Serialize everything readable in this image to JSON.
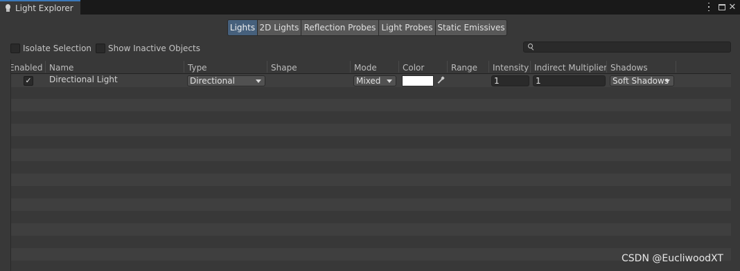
{
  "window": {
    "title": "Light Explorer",
    "icon": "light-bulb-icon"
  },
  "toolbar": {
    "tabs": [
      {
        "label": "Lights",
        "active": true
      },
      {
        "label": "2D Lights",
        "active": false
      },
      {
        "label": "Reflection Probes",
        "active": false
      },
      {
        "label": "Light Probes",
        "active": false
      },
      {
        "label": "Static Emissives",
        "active": false
      }
    ]
  },
  "filters": {
    "isolate_selection": {
      "label": "Isolate Selection",
      "checked": false
    },
    "show_inactive": {
      "label": "Show Inactive Objects",
      "checked": false
    },
    "search": {
      "value": "",
      "placeholder": ""
    }
  },
  "table": {
    "columns": [
      "Enabled",
      "Name",
      "Type",
      "Shape",
      "Mode",
      "Color",
      "Range",
      "Intensity",
      "Indirect Multiplier",
      "Shadows"
    ],
    "rows": [
      {
        "enabled": true,
        "name": "Directional Light",
        "type": "Directional",
        "shape": "",
        "mode": "Mixed",
        "color": "#ffffff",
        "range": "",
        "intensity": "1",
        "indirect_multiplier": "1",
        "shadows": "Soft Shadows"
      }
    ]
  },
  "watermark": "CSDN @EucliwoodXT",
  "colors": {
    "active_tab": "#46607c",
    "window_tab_accent": "#3a79bb",
    "background": "#383838"
  }
}
